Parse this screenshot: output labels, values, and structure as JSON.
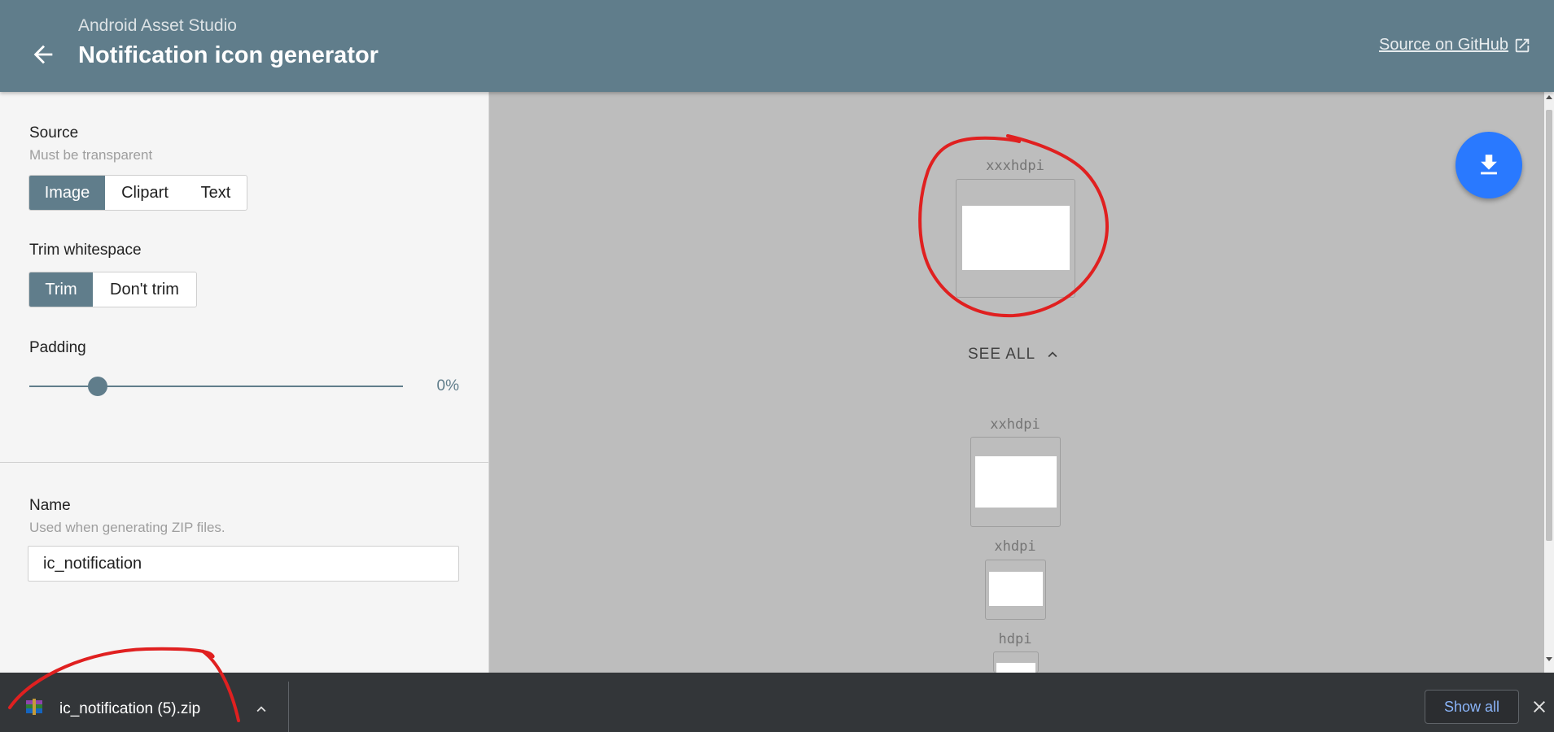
{
  "header": {
    "app_name": "Android Asset Studio",
    "title": "Notification icon generator",
    "github_link": "Source on GitHub",
    "back_icon": "arrow-back-icon",
    "external_icon": "open-in-new-icon"
  },
  "left_panel": {
    "source": {
      "label": "Source",
      "hint": "Must be transparent",
      "options": [
        "Image",
        "Clipart",
        "Text"
      ],
      "selected": "Image"
    },
    "trim": {
      "label": "Trim whitespace",
      "options": [
        "Trim",
        "Don't trim"
      ],
      "selected": "Trim"
    },
    "padding": {
      "label": "Padding",
      "value_text": "0%",
      "value": 0
    },
    "name": {
      "label": "Name",
      "hint": "Used when generating ZIP files.",
      "value": "ic_notification"
    }
  },
  "preview": {
    "densities": [
      "xxxhdpi",
      "xxhdpi",
      "xhdpi",
      "hdpi"
    ],
    "see_all": "SEE ALL",
    "download_icon": "download-icon"
  },
  "download_shelf": {
    "file_name": "ic_notification (5).zip",
    "show_all": "Show all",
    "file_icon": "archive-file-icon",
    "close_icon": "close-icon"
  },
  "colors": {
    "header": "#607d8b",
    "accent": "#607d8b",
    "fab": "#2979ff",
    "annotation": "#e02020"
  }
}
